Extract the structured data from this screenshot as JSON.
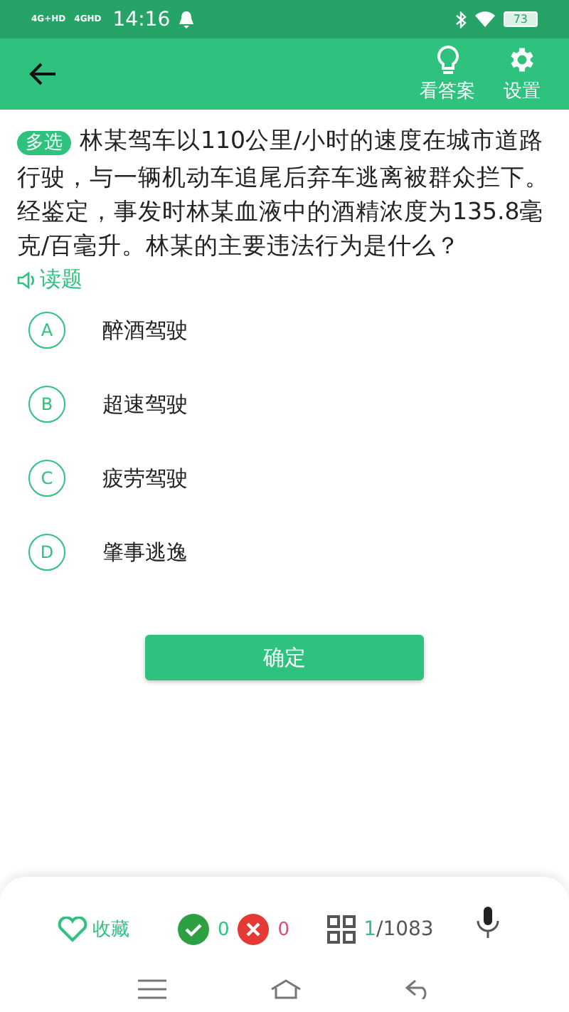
{
  "status_bar": {
    "signals": [
      "4G+HD",
      "4GHD"
    ],
    "time": "14:16",
    "battery": "73"
  },
  "toolbar": {
    "actions": [
      {
        "kind": "hint",
        "label": "看答案"
      },
      {
        "kind": "settings",
        "label": "设置"
      }
    ]
  },
  "question": {
    "type_badge": "多选",
    "text": "林某驾车以110公里/小时的速度在城市道路行驶，与一辆机动车追尾后弃车逃离被群众拦下。经鉴定，事发时林某血液中的酒精浓度为135.8毫克/百毫升。林某的主要违法行为是什么？",
    "read_aloud": "读题"
  },
  "options": [
    {
      "letter": "A",
      "text": "醉酒驾驶",
      "selected": false
    },
    {
      "letter": "B",
      "text": "超速驾驶",
      "selected": false
    },
    {
      "letter": "C",
      "text": "疲劳驾驶",
      "selected": false
    },
    {
      "letter": "D",
      "text": "肇事逃逸",
      "selected": false
    }
  ],
  "confirm_button": "确定",
  "bottom_bar": {
    "favorite": "收藏",
    "correct_count": "0",
    "wrong_count": "0",
    "progress_current": "1",
    "progress_total": "/1083"
  }
}
